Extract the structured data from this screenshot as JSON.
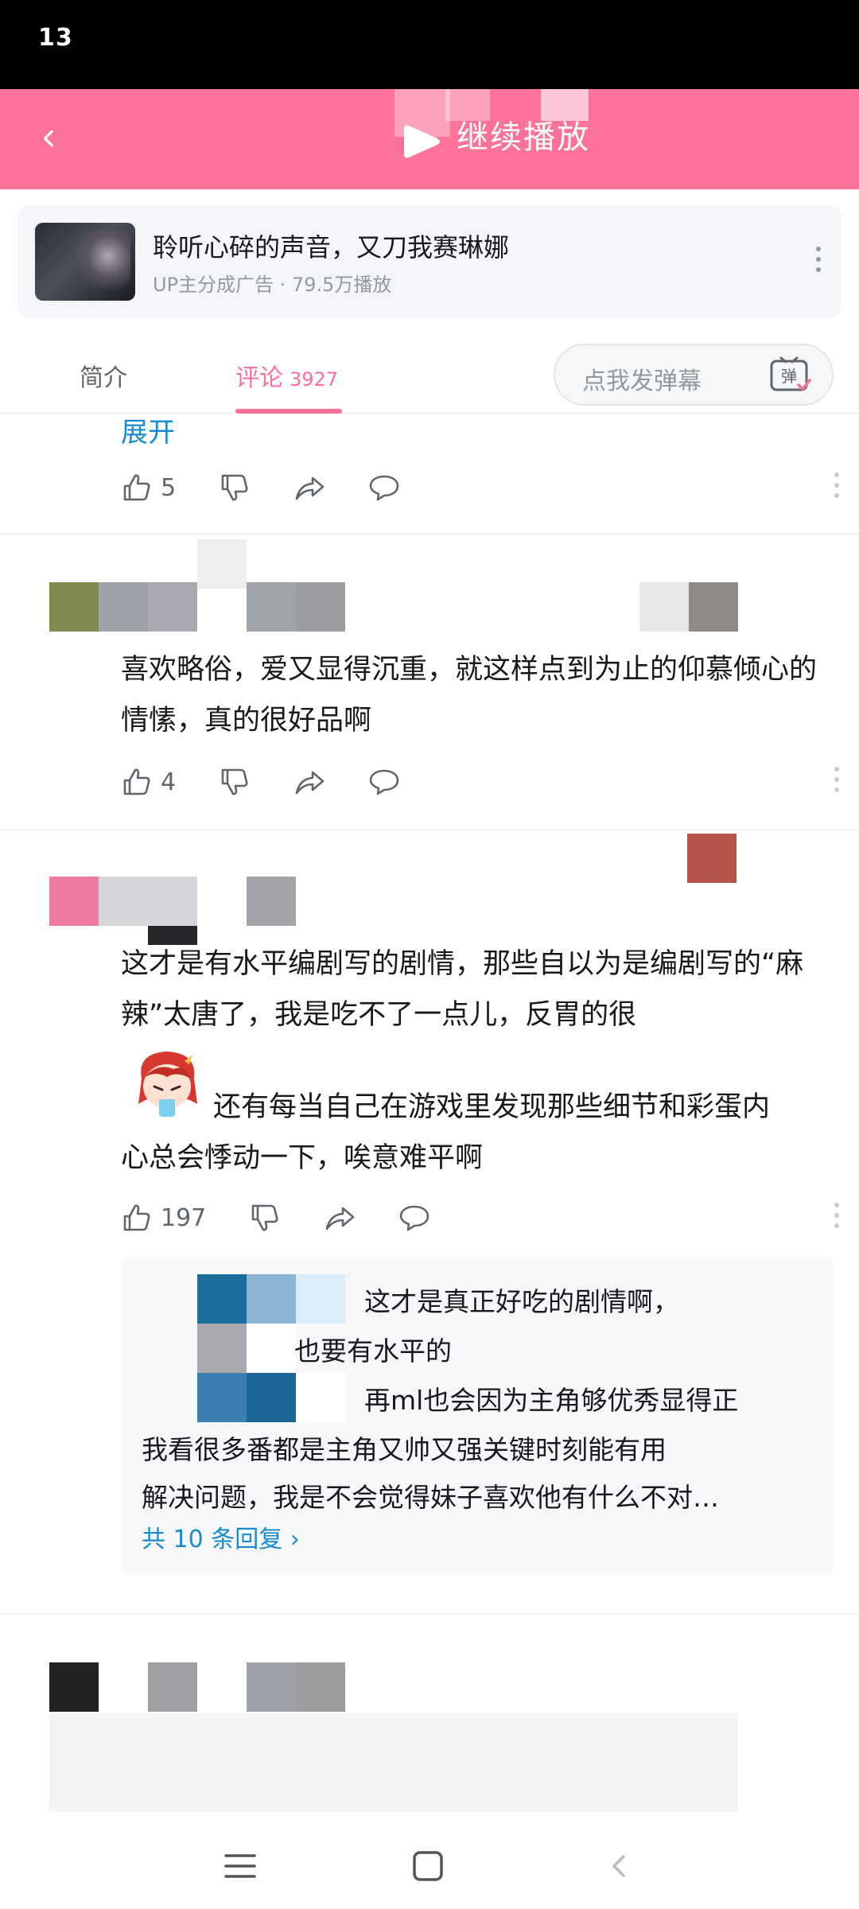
{
  "status_bar": {
    "time": "13"
  },
  "top_bar": {
    "continue_label": "继续播放",
    "accent_color": "#fb7299"
  },
  "ad": {
    "title": "聆听心碎的声音，又刀我赛琳娜",
    "meta": "UP主分成广告 · 79.5万播放"
  },
  "tabs": {
    "intro": "简介",
    "comment": "评论",
    "comment_count": "3927",
    "danmaku_placeholder": "点我发弹幕",
    "danmaku_icon_text": "弹"
  },
  "comments": [
    {
      "expand_label": "展开",
      "likes": "5"
    },
    {
      "text": "喜欢略俗，爱又显得沉重，就这样点到为止的仰慕倾心的情愫，真的很好品啊",
      "likes": "4"
    },
    {
      "text": "这才是有水平编剧写的剧情，那些自以为是编剧写的“麻辣”太唐了，我是吃不了一点儿，反胃的很",
      "text_after_emote_1": "还有每当自己在游戏里发现那些细节和彩蛋内",
      "text_after_emote_2": "心总会悸动一下，唉意难平啊",
      "likes": "197",
      "replies": {
        "line1": "这才是真正好吃的剧情啊，",
        "line2": "也要有水平的",
        "line3": "再ml也会因为主角够优秀显得正",
        "line4": "我看很多番都是主角又帅又强关键时刻能有用",
        "line5": "解决问题，我是不会觉得妹子喜欢他有什么不对…",
        "more_label": "共 10 条回复 ›"
      }
    }
  ]
}
